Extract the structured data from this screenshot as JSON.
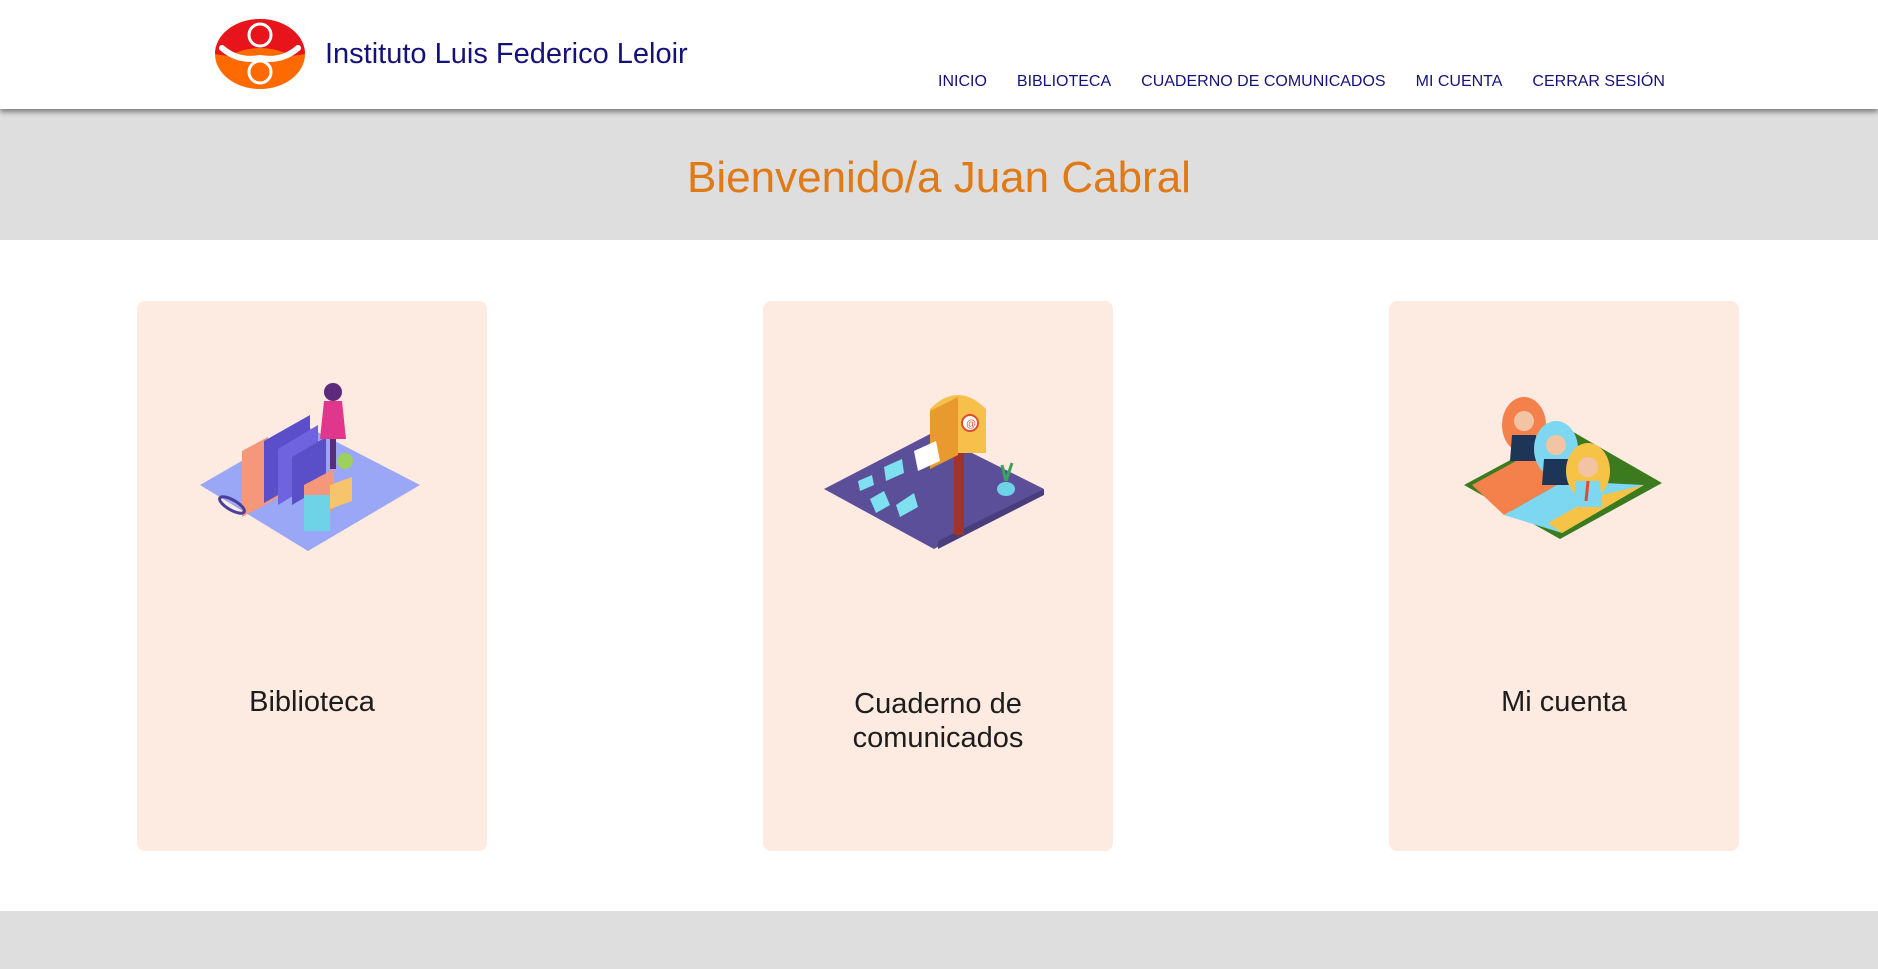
{
  "header": {
    "brand_name": "Instituto Luis Federico Leloir",
    "logo_icon": "institute-logo-icon",
    "nav": [
      {
        "label": "INICIO"
      },
      {
        "label": "BIBLIOTECA"
      },
      {
        "label": "CUADERNO DE COMUNICADOS"
      },
      {
        "label": "MI CUENTA"
      },
      {
        "label": "CERRAR SESIÓN"
      }
    ]
  },
  "hero": {
    "title": "Bienvenido/a Juan Cabral"
  },
  "cards": [
    {
      "label": "Biblioteca",
      "icon": "library-illustration-icon"
    },
    {
      "label": "Cuaderno de comunicados",
      "icon": "mailbox-illustration-icon"
    },
    {
      "label": "Mi cuenta",
      "icon": "account-people-illustration-icon"
    }
  ],
  "colors": {
    "brand_navy": "#14127a",
    "hero_orange": "#df7a16",
    "card_bg": "#fdeae0",
    "band_gray": "#dedede"
  }
}
